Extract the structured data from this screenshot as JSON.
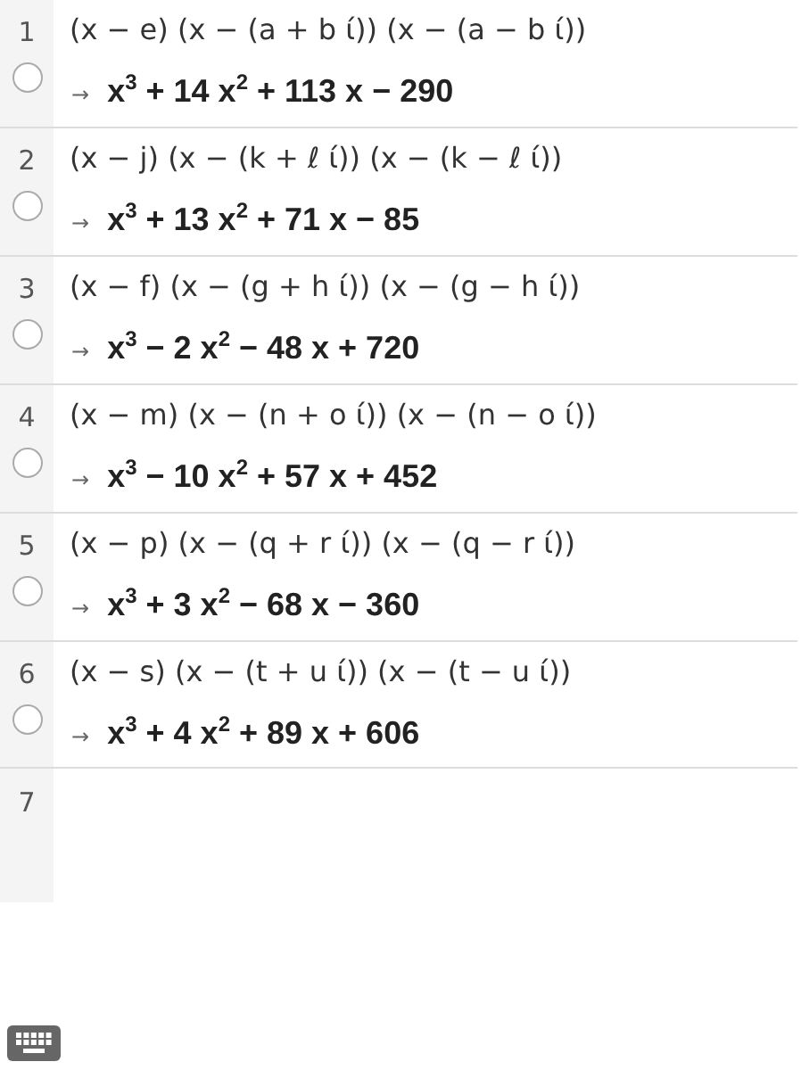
{
  "rows": [
    {
      "number": "1",
      "input": "(x − e) (x − (a + b ί)) (x − (a − b ί))",
      "arrow": "→",
      "output": "x$^{3}$ + 14 x$^{2}$ + 113 x − 290",
      "visible": false
    },
    {
      "number": "2",
      "input": "(x − j) (x − (k + ℓ ί)) (x − (k − ℓ ί))",
      "arrow": "→",
      "output": "x$^{3}$ + 13 x$^{2}$ + 71 x − 85",
      "visible": false
    },
    {
      "number": "3",
      "input": "(x − f) (x − (g + h ί)) (x − (g − h ί))",
      "arrow": "→",
      "output": "x$^{3}$ − 2 x$^{2}$ − 48 x + 720",
      "visible": false
    },
    {
      "number": "4",
      "input": "(x − m) (x − (n + o ί)) (x − (n − o ί))",
      "arrow": "→",
      "output": "x$^{3}$ − 10 x$^{2}$ + 57 x + 452",
      "visible": false
    },
    {
      "number": "5",
      "input": "(x − p) (x − (q + r ί)) (x − (q − r ί))",
      "arrow": "→",
      "output": "x$^{3}$ + 3 x$^{2}$ − 68 x − 360",
      "visible": false
    },
    {
      "number": "6",
      "input": "(x − s) (x − (t + u ί)) (x − (t − u ί))",
      "arrow": "→",
      "output": "x$^{3}$ + 4 x$^{2}$ + 89 x + 606",
      "visible": false
    }
  ],
  "empty_row": {
    "number": "7"
  }
}
